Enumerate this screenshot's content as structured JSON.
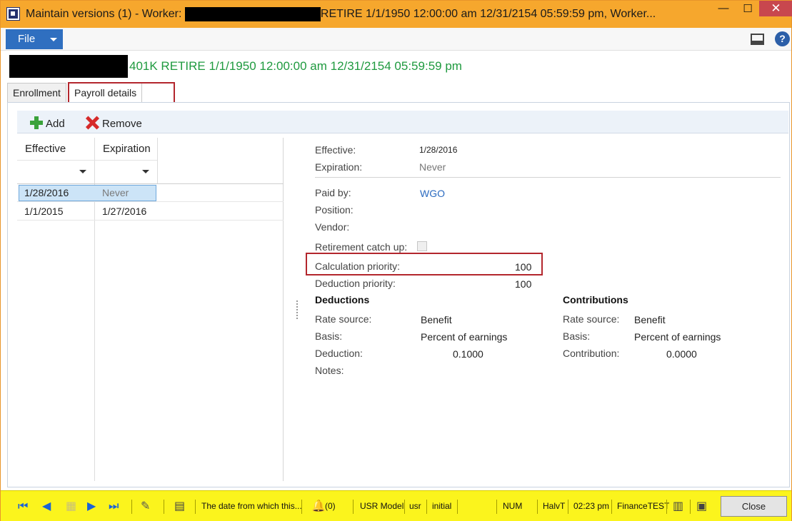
{
  "window": {
    "title_prefix": "Maintain versions (1) - Worker:",
    "title_suffix": "RETIRE 1/1/1950 12:00:00 am 12/31/2154 05:59:59 pm, Worker...",
    "minimize": "—",
    "maximize": "☐",
    "close": "✕"
  },
  "menu": {
    "file_label": "File"
  },
  "header": {
    "text": "401K RETIRE 1/1/1950 12:00:00 am 12/31/2154 05:59:59 pm"
  },
  "tabs": [
    {
      "label": "Enrollment"
    },
    {
      "label": "Payroll details"
    }
  ],
  "toolbar": {
    "add_label": "Add",
    "remove_label": "Remove"
  },
  "grid": {
    "headers": [
      "Effective",
      "Expiration"
    ],
    "rows": [
      {
        "effective": "1/28/2016",
        "expiration": "Never",
        "selected": true
      },
      {
        "effective": "1/1/2015",
        "expiration": "1/27/2016",
        "selected": false
      }
    ]
  },
  "detail": {
    "effective_label": "Effective:",
    "effective_value": "1/28/2016",
    "expiration_label": "Expiration:",
    "expiration_value": "Never",
    "paid_by_label": "Paid by:",
    "paid_by_value": "WGO",
    "position_label": "Position:",
    "vendor_label": "Vendor:",
    "catch_up_label": "Retirement catch up:",
    "calc_priority_label": "Calculation priority:",
    "calc_priority_value": "100",
    "deduction_priority_label": "Deduction priority:",
    "deduction_priority_value": "100",
    "deductions": {
      "title": "Deductions",
      "rate_source_label": "Rate source:",
      "rate_source_value": "Benefit",
      "basis_label": "Basis:",
      "basis_value": "Percent of earnings",
      "amount_label": "Deduction:",
      "amount_value": "0.1000",
      "notes_label": "Notes:"
    },
    "contributions": {
      "title": "Contributions",
      "rate_source_label": "Rate source:",
      "rate_source_value": "Benefit",
      "basis_label": "Basis:",
      "basis_value": "Percent of earnings",
      "amount_label": "Contribution:",
      "amount_value": "0.0000"
    }
  },
  "statusbar": {
    "help_text": "The date from which this...",
    "notifications": "(0)",
    "model": "USR Model",
    "layer": "usr",
    "company_init": "initial",
    "num": "NUM",
    "user": "HalvT",
    "time": "02:23 pm",
    "environment": "FinanceTEST",
    "close_label": "Close"
  },
  "colors": {
    "accent": "#2f6fc0",
    "header_green": "#1f9a3f",
    "status_bg": "#fbf41d",
    "highlight_red": "#b3262d"
  }
}
